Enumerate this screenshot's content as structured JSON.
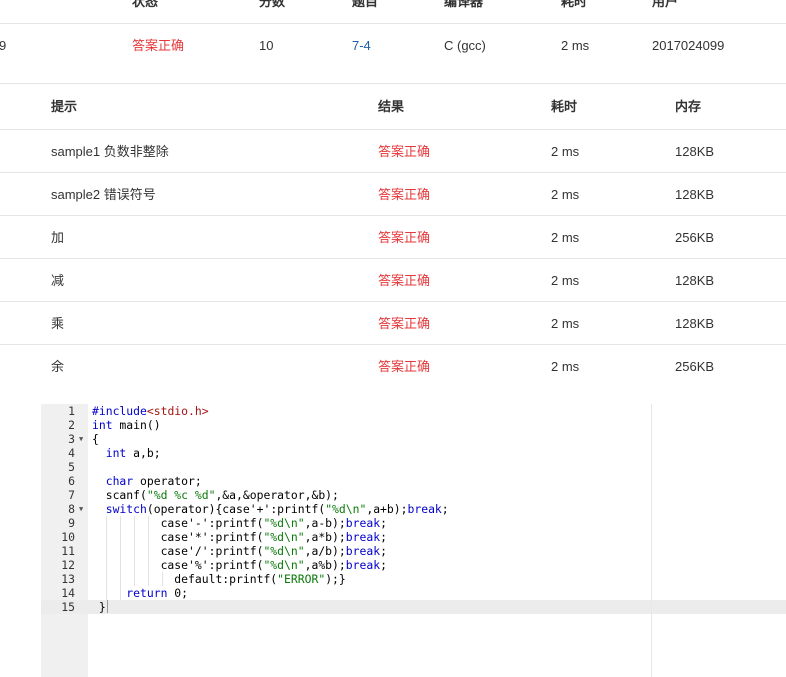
{
  "submission": {
    "headers": [
      "状态",
      "分数",
      "题目",
      "编译器",
      "耗时",
      "用户"
    ],
    "row": {
      "id_partial": "9",
      "status": "答案正确",
      "score": "10",
      "problem": "7-4",
      "compiler": "C (gcc)",
      "time": "2 ms",
      "user": "2017024099"
    }
  },
  "tests": {
    "headers": [
      "提示",
      "结果",
      "耗时",
      "内存"
    ],
    "rows": [
      {
        "hint": "sample1 负数非整除",
        "result": "答案正确",
        "time": "2 ms",
        "memory": "128KB"
      },
      {
        "hint": "sample2 错误符号",
        "result": "答案正确",
        "time": "2 ms",
        "memory": "128KB"
      },
      {
        "hint": "加",
        "result": "答案正确",
        "time": "2 ms",
        "memory": "256KB"
      },
      {
        "hint": "减",
        "result": "答案正确",
        "time": "2 ms",
        "memory": "128KB"
      },
      {
        "hint": "乘",
        "result": "答案正确",
        "time": "2 ms",
        "memory": "128KB"
      },
      {
        "hint": "余",
        "result": "答案正确",
        "time": "2 ms",
        "memory": "256KB"
      }
    ]
  },
  "code": {
    "line_numbers": [
      "1",
      "2",
      "3",
      "4",
      "5",
      "6",
      "7",
      "8",
      "9",
      "10",
      "11",
      "12",
      "13",
      "14",
      "15"
    ],
    "l1": {
      "pp": "#include",
      "inc": "<stdio.h>"
    },
    "l2": {
      "kw": "int",
      "rest": " main()"
    },
    "l3": "{",
    "l4": {
      "kw": "int",
      "rest": " a,b;"
    },
    "l6": {
      "kw": "char",
      "rest": " operator;"
    },
    "l7": {
      "a": "scanf(",
      "s": "\"%d %c %d\"",
      "b": ",&a,&operator,&b);"
    },
    "l8": {
      "kw": "switch",
      "a": "(operator){case'+':printf(",
      "s": "\"%d\\n\"",
      "b": ",a+b);",
      "kw2": "break",
      "c": ";"
    },
    "l9": {
      "a": "case'-':printf(",
      "s": "\"%d\\n\"",
      "b": ",a-b);",
      "kw": "break",
      "c": ";"
    },
    "l10": {
      "a": "case'*':printf(",
      "s": "\"%d\\n\"",
      "b": ",a*b);",
      "kw": "break",
      "c": ";"
    },
    "l11": {
      "a": "case'/':printf(",
      "s": "\"%d\\n\"",
      "b": ",a/b);",
      "kw": "break",
      "c": ";"
    },
    "l12": {
      "a": "case'%':printf(",
      "s": "\"%d\\n\"",
      "b": ",a%b);",
      "kw": "break",
      "c": ";"
    },
    "l13": {
      "a": "default:printf(",
      "s": "\"ERROR\"",
      "b": ");}"
    },
    "l14": {
      "kw": "return",
      "rest": " 0;"
    },
    "l15": "}"
  },
  "colors": {
    "accepted": "#e4393c",
    "link": "#1f5fa8",
    "gutter": "#f0f0f0",
    "border": "#e6e6e6"
  }
}
